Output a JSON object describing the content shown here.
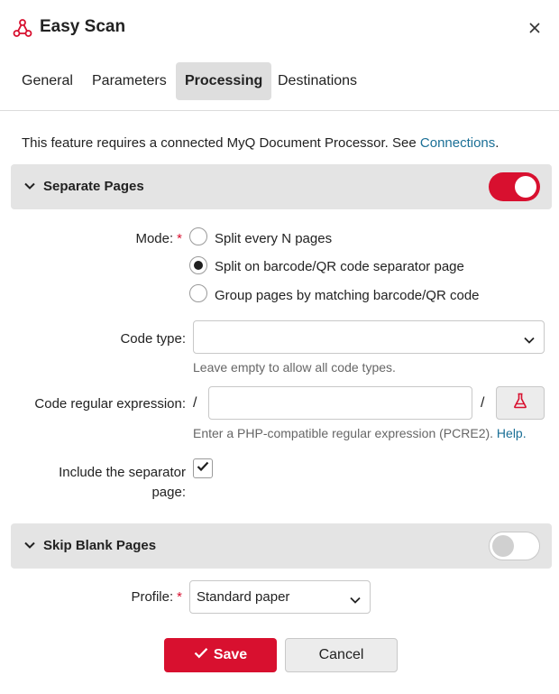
{
  "window": {
    "title": "Easy Scan",
    "app_icon": "network-icon",
    "close_icon": "close-icon"
  },
  "tabs": [
    {
      "label": "General",
      "active": false
    },
    {
      "label": "Parameters",
      "active": false
    },
    {
      "label": "Processing",
      "active": true
    },
    {
      "label": "Destinations",
      "active": false
    }
  ],
  "info": {
    "text": "This feature requires a connected MyQ Document Processor. See ",
    "link": "Connections",
    "suffix": "."
  },
  "separate_pages": {
    "title": "Separate Pages",
    "enabled": true,
    "mode_label": "Mode:",
    "required_mark": "*",
    "mode_options": [
      {
        "label": "Split every N pages",
        "checked": false
      },
      {
        "label": "Split on barcode/QR code separator page",
        "checked": true
      },
      {
        "label": "Group pages by matching barcode/QR code",
        "checked": false
      }
    ],
    "code_type_label": "Code type:",
    "code_type_value": "",
    "code_type_hint": "Leave empty to allow all code types.",
    "regex_label": "Code regular expression:",
    "regex_delim_open": "/",
    "regex_delim_close": "/",
    "regex_value": "",
    "regex_hint": "Enter a PHP-compatible regular expression (PCRE2). ",
    "regex_help_link": "Help.",
    "include_separator_label_1": "Include the separator",
    "include_separator_label_2": "page:",
    "include_separator_checked": true
  },
  "skip_blank_pages": {
    "title": "Skip Blank Pages",
    "enabled": false,
    "profile_label": "Profile:",
    "required_mark": "*",
    "profile_value": "Standard paper"
  },
  "buttons": {
    "save": "Save",
    "cancel": "Cancel"
  },
  "colors": {
    "accent": "#d8102f",
    "link": "#1a6f96",
    "section_bg": "#e4e4e4"
  }
}
